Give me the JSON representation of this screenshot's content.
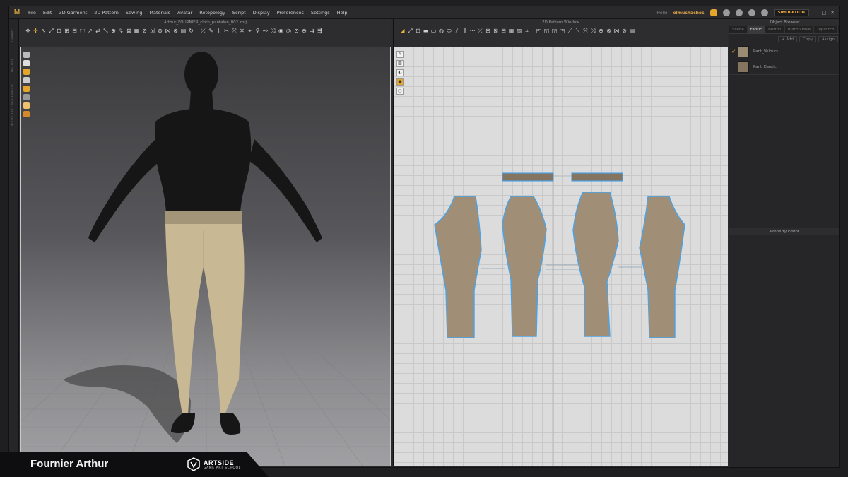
{
  "menubar": {
    "items": [
      "File",
      "Edit",
      "3D Garment",
      "2D Pattern",
      "Sewing",
      "Materials",
      "Avatar",
      "Retopology",
      "Script",
      "Display",
      "Preferences",
      "Settings",
      "Help"
    ],
    "user_label": "Hello",
    "user_name": "elmuchachos",
    "mode": "SIMULATION"
  },
  "window3d": {
    "title": "Arthur_FOURNIER_cloth_pantalon_002.zprj",
    "side_labels": [
      "LIBRARY",
      "HISTORY",
      "MODULAR CONFIGURATOR"
    ]
  },
  "window2d": {
    "title": "2D Pattern Window"
  },
  "object_browser": {
    "title": "Object Browser",
    "tabs": [
      "Scene",
      "Fabric",
      "Button",
      "Button Hole",
      "Topstitch"
    ],
    "active_tab": "Fabric",
    "actions": [
      "+ Add",
      "Copy",
      "Assign"
    ],
    "fabrics": [
      {
        "name": "Pant_Velours",
        "color": "#9c8b73",
        "selected": true
      },
      {
        "name": "Pant_Elastic",
        "color": "#857560",
        "selected": false
      }
    ]
  },
  "property_editor": {
    "title": "Property Editor"
  },
  "footer": {
    "author": "Fournier Arthur",
    "brand_name": "ARTSIDE",
    "brand_sub": "GAME ART SCHOOL"
  },
  "colors": {
    "accent": "#e3a52c",
    "pattern_fill": "#a08e77",
    "pattern_outline": "#4aa3e8",
    "pants": "#c8b894",
    "avatar": "#161616"
  }
}
